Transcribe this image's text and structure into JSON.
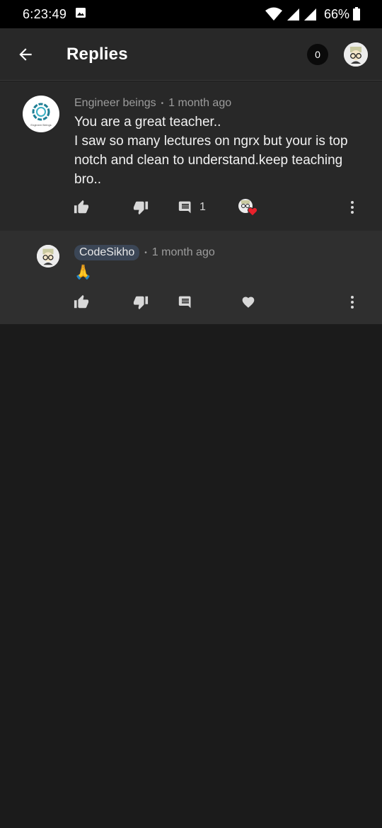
{
  "status": {
    "time": "6:23:49",
    "battery": "66%"
  },
  "header": {
    "title": "Replies",
    "notification_count": "0"
  },
  "comment": {
    "author": "Engineer beings",
    "timestamp": "1 month ago",
    "avatar_logo_text": "Engineer Beings",
    "text_lines": [
      "You are a great teacher..",
      "I saw so many lectures on ngrx but your is top notch and clean to understand.keep teaching bro.."
    ],
    "reply_count": "1"
  },
  "reply": {
    "author": "CodeSikho",
    "timestamp": "1 month ago",
    "text": "🙏"
  },
  "colors": {
    "background": "#1b1b1b",
    "surface": "#282828",
    "reply_surface": "#2f2f2f",
    "heart": "#e8212b",
    "author_chip": "#3b4656"
  },
  "icons": [
    "back-arrow-icon",
    "like-icon",
    "dislike-icon",
    "reply-icon",
    "more-icon",
    "heart-icon",
    "wifi-icon",
    "signal-icon",
    "battery-icon",
    "image-icon"
  ]
}
